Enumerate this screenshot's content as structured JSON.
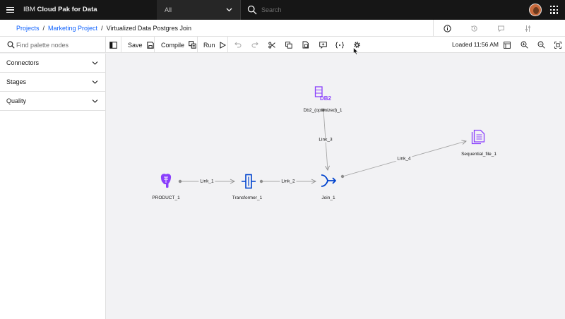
{
  "header": {
    "brand_prefix": "IBM ",
    "brand_name": "Cloud Pak for Data",
    "scope_value": "All",
    "search_placeholder": "Search"
  },
  "breadcrumb": {
    "items": [
      "Projects",
      "Marketing Project"
    ],
    "current": "Virtualized Data Postgres Join",
    "separator": "/"
  },
  "toolbar": {
    "palette_search_placeholder": "Find palette nodes",
    "save_label": "Save",
    "compile_label": "Compile",
    "run_label": "Run",
    "loaded_text": "Loaded 11:56 AM"
  },
  "palette": {
    "sections": [
      {
        "label": "Connectors"
      },
      {
        "label": "Stages"
      },
      {
        "label": "Quality"
      }
    ]
  },
  "canvas": {
    "nodes": [
      {
        "id": "product",
        "label": "PRODUCT_1",
        "icon": "postgresql-icon"
      },
      {
        "id": "transformer",
        "label": "Transformer_1",
        "icon": "transformer-icon"
      },
      {
        "id": "join",
        "label": "Join_1",
        "icon": "join-icon"
      },
      {
        "id": "db2",
        "label": "Db2_(optimized)_1",
        "icon": "db2-icon"
      },
      {
        "id": "seqfile",
        "label": "Sequential_file_1",
        "icon": "document-icon"
      }
    ],
    "links": [
      {
        "id": "link1",
        "label": "Link_1"
      },
      {
        "id": "link2",
        "label": "Link_2"
      },
      {
        "id": "link3",
        "label": "Link_3"
      },
      {
        "id": "link4",
        "label": "Link_4"
      }
    ]
  },
  "colors": {
    "header_bg": "#161616",
    "accent_blue": "#0f62fe",
    "stage_blue": "#0043ce",
    "connector_purple": "#8a3ffc",
    "canvas_bg": "#f2f2f4"
  }
}
